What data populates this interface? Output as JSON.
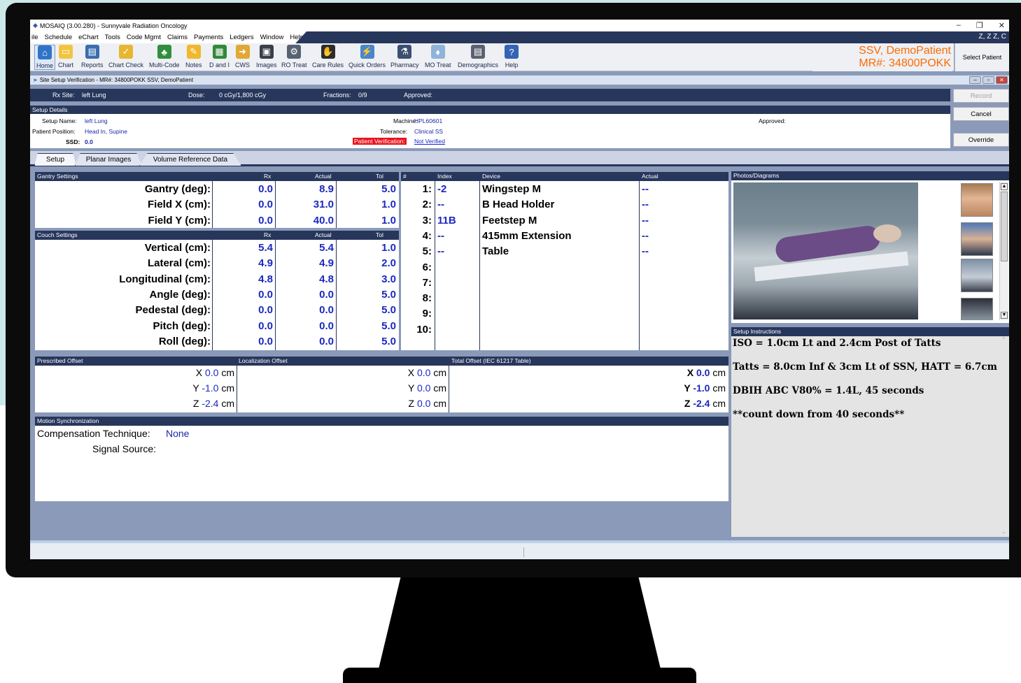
{
  "app": {
    "title": "MOSAIQ (3.00.280) - Sunnyvale Radiation Oncology",
    "user": "Z, Z Z, C"
  },
  "menu": [
    "ile",
    "Schedule",
    "eChart",
    "Tools",
    "Code Mgmt",
    "Claims",
    "Payments",
    "Ledgers",
    "Window",
    "Help"
  ],
  "toolbar": {
    "home": "Home",
    "chart": "Chart",
    "reports": "Reports",
    "chart_check": "Chart Check",
    "multi_code": "Multi-Code",
    "notes": "Notes",
    "d_and_i": "D and I",
    "cws": "CWS",
    "images": "Images",
    "ro_treat": "RO Treat",
    "care_rules": "Care Rules",
    "quick_orders": "Quick Orders",
    "pharmacy": "Pharmacy",
    "mo_treat": "MO Treat",
    "demographics": "Demographics",
    "help": "Help"
  },
  "patient": {
    "name": "SSV, DemoPatient",
    "mr": "MR#: 34800POKK",
    "select_label": "Select Patient"
  },
  "window": {
    "title": "Site Setup Verification - MR#: 34800POKK  SSV, DemoPatient"
  },
  "rx": {
    "site_label": "Rx Site:",
    "site": "left Lung",
    "dose_label": "Dose:",
    "dose": "0 cGy/1,800 cGy",
    "fractions_label": "Fractions:",
    "fractions": "0/9",
    "approved_label": "Approved:"
  },
  "buttons": {
    "record": "Record",
    "cancel": "Cancel",
    "override": "Override"
  },
  "setup": {
    "header": "Setup Details",
    "name_label": "Setup Name:",
    "name": "left Lung",
    "position_label": "Patient Position:",
    "position": "Head In, Supine",
    "ssd_label": "SSD:",
    "ssd": "0.0",
    "machine_label": "Machine:",
    "machine": "HPL60601",
    "tolerance_label": "Tolerance:",
    "tolerance": "Clinical SS",
    "pv_label": "Patient Verification:",
    "pv": "Not Verified",
    "approved_label": "Approved:"
  },
  "tabs": [
    "Setup",
    "Planar Images",
    "Volume Reference Data"
  ],
  "gantry": {
    "header": "Gantry Settings",
    "col_rx": "Rx",
    "col_actual": "Actual",
    "col_tol": "Tol",
    "rows": [
      {
        "label": "Gantry (deg):",
        "rx": "0.0",
        "actual": "8.9",
        "tol": "5.0"
      },
      {
        "label": "Field X (cm):",
        "rx": "0.0",
        "actual": "31.0",
        "tol": "1.0"
      },
      {
        "label": "Field Y (cm):",
        "rx": "0.0",
        "actual": "40.0",
        "tol": "1.0"
      }
    ]
  },
  "couch": {
    "header": "Couch Settings",
    "col_rx": "Rx",
    "col_actual": "Actual",
    "col_tol": "Tol",
    "rows": [
      {
        "label": "Vertical (cm):",
        "rx": "5.4",
        "actual": "5.4",
        "tol": "1.0"
      },
      {
        "label": "Lateral (cm):",
        "rx": "4.9",
        "actual": "4.9",
        "tol": "2.0"
      },
      {
        "label": "Longitudinal (cm):",
        "rx": "4.8",
        "actual": "4.8",
        "tol": "3.0"
      },
      {
        "label": "Angle (deg):",
        "rx": "0.0",
        "actual": "0.0",
        "tol": "5.0"
      },
      {
        "label": "Pedestal (deg):",
        "rx": "0.0",
        "actual": "0.0",
        "tol": "5.0"
      },
      {
        "label": "Pitch (deg):",
        "rx": "0.0",
        "actual": "0.0",
        "tol": "5.0"
      },
      {
        "label": "Roll (deg):",
        "rx": "0.0",
        "actual": "0.0",
        "tol": "5.0"
      }
    ]
  },
  "devices": {
    "col_num": "#",
    "col_index": "Index",
    "col_device": "Device",
    "col_actual": "Actual",
    "rows": [
      {
        "n": "1:",
        "index": "-2",
        "device": "Wingstep M",
        "actual": "--"
      },
      {
        "n": "2:",
        "index": "--",
        "device": "B Head Holder",
        "actual": "--"
      },
      {
        "n": "3:",
        "index": "11B",
        "device": "Feetstep M",
        "actual": "--"
      },
      {
        "n": "4:",
        "index": "--",
        "device": "415mm Extension",
        "actual": "--"
      },
      {
        "n": "5:",
        "index": "--",
        "device": "Table",
        "actual": "--"
      },
      {
        "n": "6:",
        "index": "",
        "device": "",
        "actual": ""
      },
      {
        "n": "7:",
        "index": "",
        "device": "",
        "actual": ""
      },
      {
        "n": "8:",
        "index": "",
        "device": "",
        "actual": ""
      },
      {
        "n": "9:",
        "index": "",
        "device": "",
        "actual": ""
      },
      {
        "n": "10:",
        "index": "",
        "device": "",
        "actual": ""
      }
    ]
  },
  "offsets": {
    "prescribed_header": "Prescribed Offset",
    "localization_header": "Localization Offset",
    "total_header": "Total Offset (IEC 61217 Table)",
    "prescribed": [
      {
        "axis": "X",
        "val": "0.0",
        "unit": "cm"
      },
      {
        "axis": "Y",
        "val": "-1.0",
        "unit": "cm"
      },
      {
        "axis": "Z",
        "val": "-2.4",
        "unit": "cm"
      }
    ],
    "localization": [
      {
        "axis": "X",
        "val": "0.0",
        "unit": "cm"
      },
      {
        "axis": "Y",
        "val": "0.0",
        "unit": "cm"
      },
      {
        "axis": "Z",
        "val": "0.0",
        "unit": "cm"
      }
    ],
    "total": [
      {
        "axis": "X",
        "val": "0.0",
        "unit": "cm"
      },
      {
        "axis": "Y",
        "val": "-1.0",
        "unit": "cm"
      },
      {
        "axis": "Z",
        "val": "-2.4",
        "unit": "cm"
      }
    ]
  },
  "motion": {
    "header": "Motion Synchronization",
    "comp_label": "Compensation Technique:",
    "comp": "None",
    "signal_label": "Signal Source:"
  },
  "photos": {
    "header": "Photos/Diagrams"
  },
  "instructions": {
    "header": "Setup Instructions",
    "lines": [
      "ISO = 1.0cm Lt and 2.4cm Post of Tatts",
      "Tatts = 8.0cm Inf & 3cm Lt of SSN, HATT = 6.7cm",
      "DBIH ABC V80% = 1.4L, 45 seconds",
      "**count down from 40 seconds**"
    ]
  },
  "colors": {
    "header_navy": "#27365b",
    "value_blue": "#1b28c0",
    "patient_orange": "#ff6a00",
    "verify_red": "#e8141e"
  }
}
